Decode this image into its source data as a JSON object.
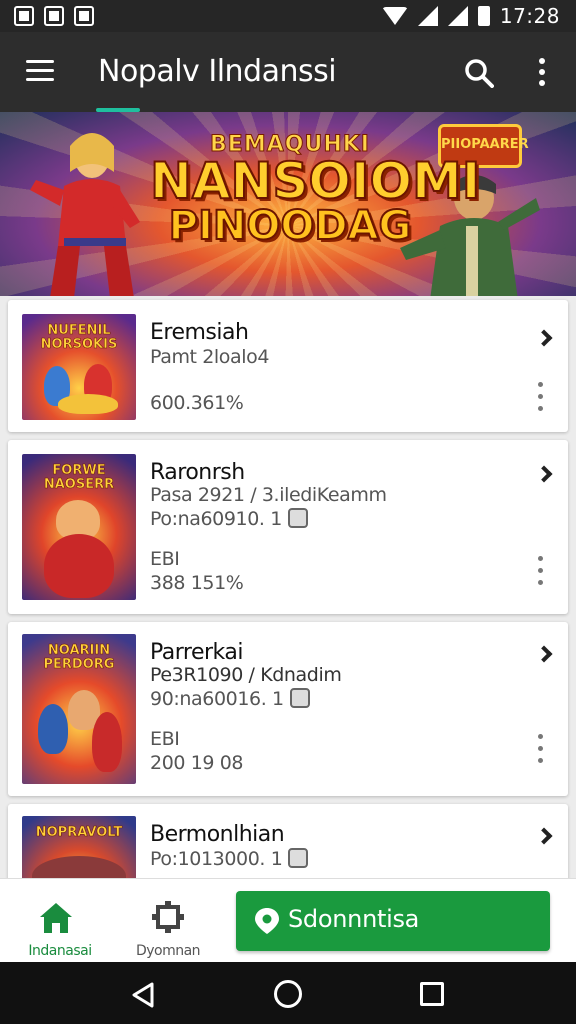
{
  "status_bar": {
    "time": "17:28"
  },
  "app_bar": {
    "title": "Nopalv Ilndanssi"
  },
  "banner": {
    "top_text": "BEMAQUHKI",
    "main_text": "NANSOIOMI",
    "sub_text": "PINOODAG",
    "badge_text": "PIIOPAARER"
  },
  "cards": [
    {
      "title": "Eremsiah",
      "lines": [
        "Pamt 2loalo4"
      ],
      "stat": "600.361%",
      "thumb_text": "NUFENIL NORSOKIS",
      "has_badge_line": false
    },
    {
      "title": "Raronrsh",
      "lines": [
        "Pasa 2921 / 3.ilediKeamm",
        "Po:na60910. 1"
      ],
      "tag": "ЕBI",
      "stat": "388 151%",
      "thumb_text": "FORWE NAOSERR",
      "has_badge_line": true
    },
    {
      "title": "Parrerkai",
      "lines": [
        "Pe3R1090 / Kdnadim",
        "90:na60016. 1"
      ],
      "tag": "ЕBI",
      "stat": "200 19 08",
      "thumb_text": "NOARIIN PERDORG",
      "has_badge_line": true
    },
    {
      "title": "Bermonlhian",
      "lines": [
        "Po:1013000. 1"
      ],
      "thumb_text": "NOPRAVOLT",
      "has_badge_line": true
    }
  ],
  "bottom_bar": {
    "home_label": "Indanasai",
    "second_label": "Dyomnan",
    "action_label": "Sdonnntisa"
  },
  "colors": {
    "accent": "#1a9a3e",
    "tab_indicator": "#1fbf9e",
    "app_bar": "#2d2d2d"
  }
}
